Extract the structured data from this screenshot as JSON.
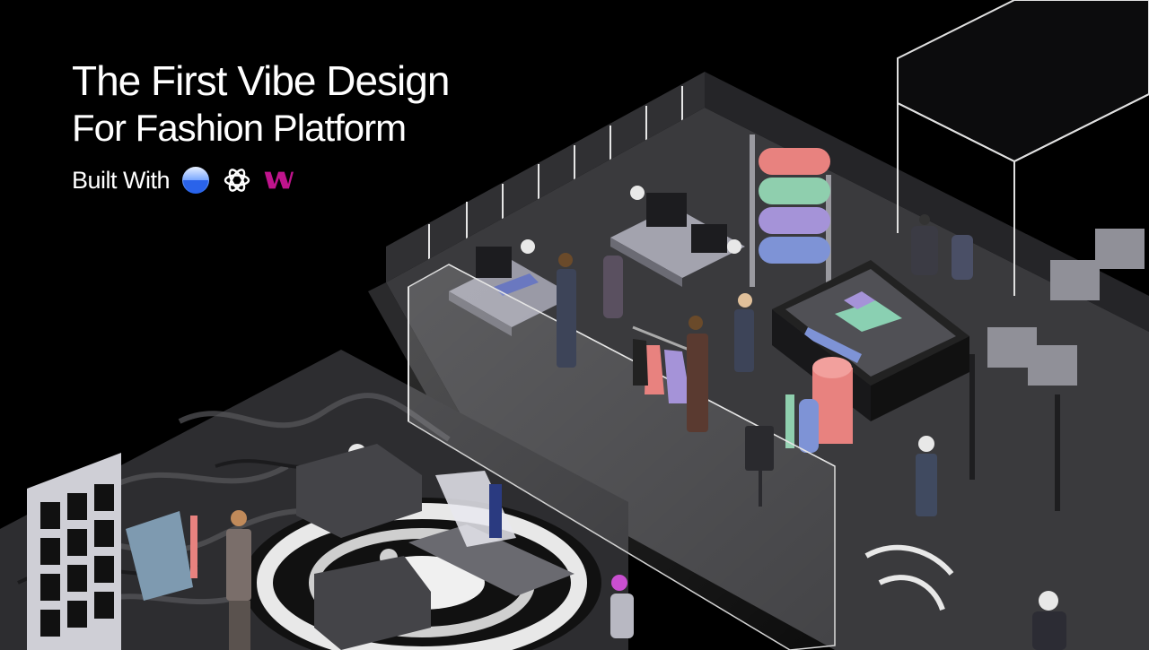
{
  "hero": {
    "title_line1": "The First Vibe Design",
    "title_line2": "For Fashion Platform",
    "built_with": "Built With",
    "logos": [
      "blue-circle-logo",
      "openai-knot-logo",
      "webflow-w-logo"
    ]
  },
  "colors": {
    "background": "#000000",
    "text": "#ffffff",
    "floor": "#2b2b2e",
    "roll_pink": "#e8827f",
    "roll_green": "#8fcfae",
    "roll_purple": "#a593d8",
    "roll_blue": "#7e93d6",
    "accent_magenta": "#c0148d",
    "accent_blue": "#2f6cf0"
  }
}
